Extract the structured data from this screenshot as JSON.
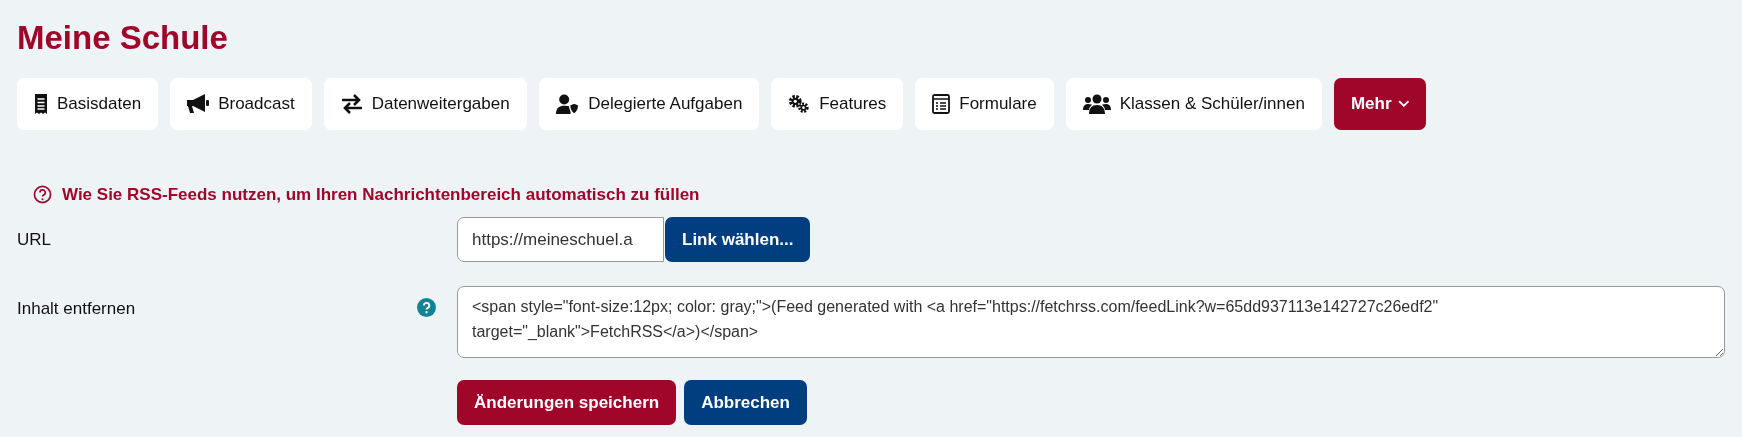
{
  "page_title": "Meine Schule",
  "nav": [
    {
      "label": "Basisdaten",
      "kind": "link"
    },
    {
      "label": "Broadcast",
      "kind": "link"
    },
    {
      "label": "Datenweitergaben",
      "kind": "link"
    },
    {
      "label": "Delegierte Aufgaben",
      "kind": "link"
    },
    {
      "label": "Features",
      "kind": "link"
    },
    {
      "label": "Formulare",
      "kind": "link"
    },
    {
      "label": "Klassen & Schüler/innen",
      "kind": "link"
    },
    {
      "label": "Mehr",
      "kind": "dropdown"
    }
  ],
  "help_link": "Wie Sie RSS-Feeds nutzen, um Ihren Nachrichtenbereich automatisch zu füllen",
  "form": {
    "url": {
      "label": "URL",
      "value": "https://meineschuel.a",
      "button": "Link wählen..."
    },
    "remove": {
      "label": "Inhalt entfernen",
      "value": "<span style=\"font-size:12px; color: gray;\">(Feed generated with <a href=\"https://fetchrss.com/feedLink?w=65dd937113e142727c26edf2\" target=\"_blank\">FetchRSS</a>)</span>"
    },
    "buttons": [
      {
        "label": "Änderungen speichern",
        "kind": "primary"
      },
      {
        "label": "Abbrechen",
        "kind": "secondary"
      }
    ]
  }
}
